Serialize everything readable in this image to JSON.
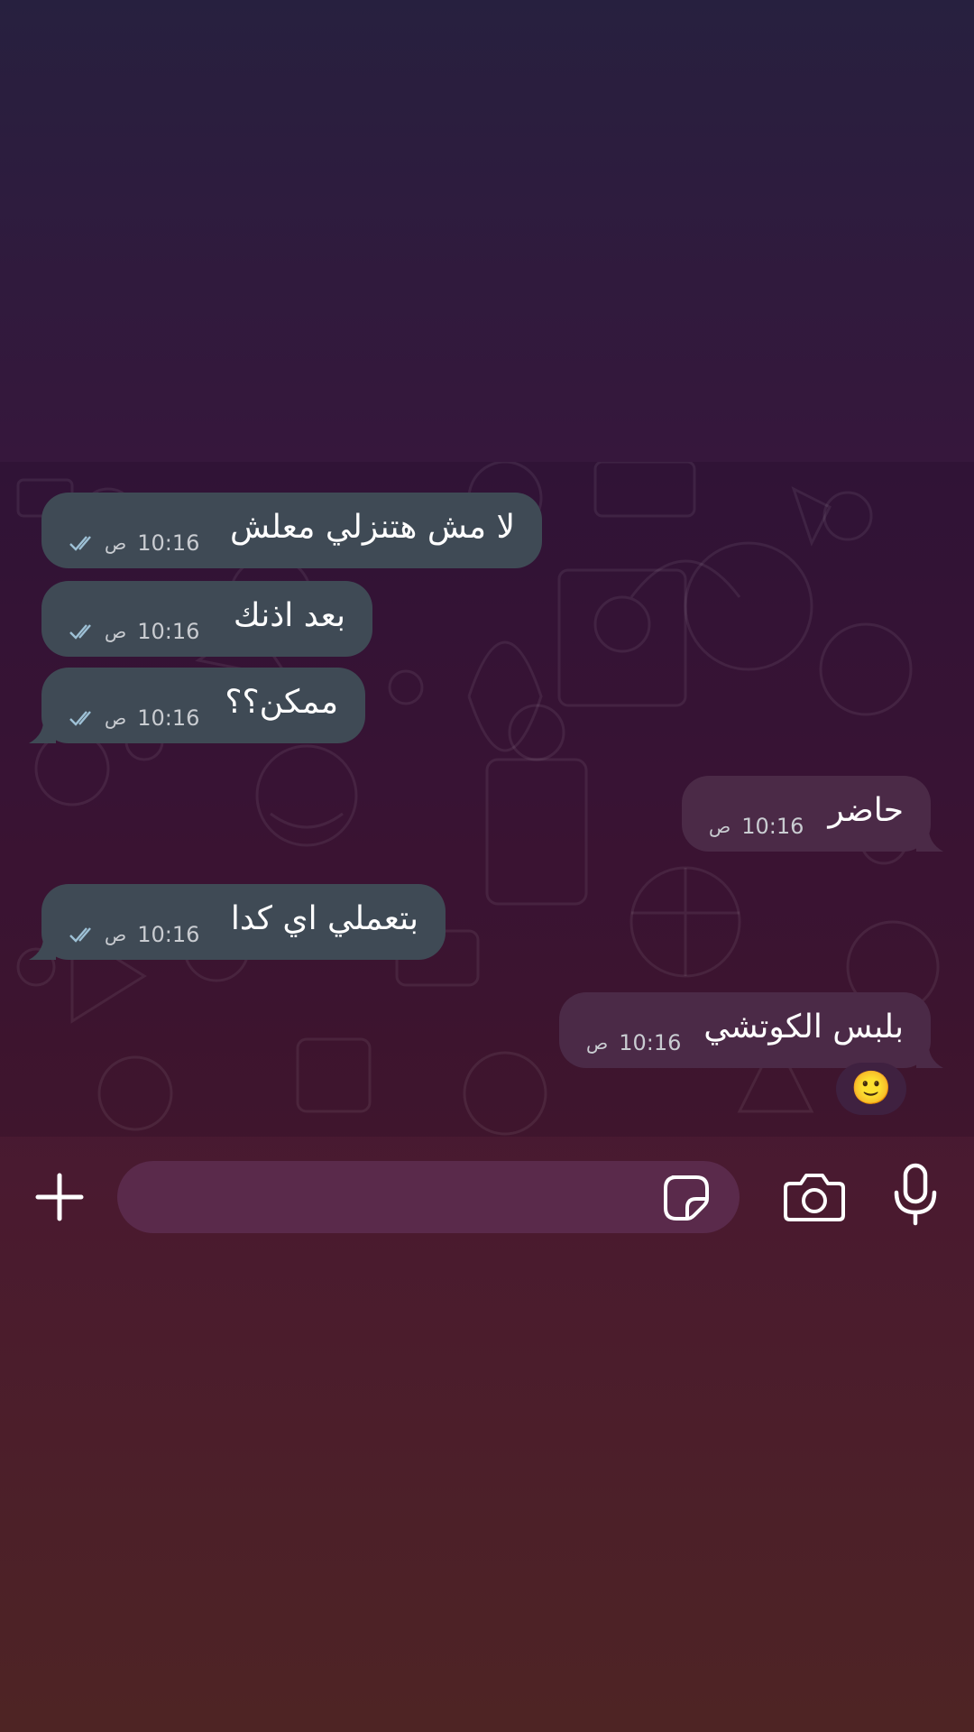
{
  "messages": [
    {
      "text": "لا مش هتنزلي معلش",
      "time": "10:16",
      "ampm": "ص",
      "direction": "outgoing",
      "status": "read"
    },
    {
      "text": "بعد اذنك",
      "time": "10:16",
      "ampm": "ص",
      "direction": "outgoing",
      "status": "read"
    },
    {
      "text": "ممكن؟؟",
      "time": "10:16",
      "ampm": "ص",
      "direction": "outgoing",
      "status": "read"
    },
    {
      "text": "حاضر",
      "time": "10:16",
      "ampm": "ص",
      "direction": "incoming"
    },
    {
      "text": "بتعملي اي كدا",
      "time": "10:16",
      "ampm": "ص",
      "direction": "outgoing",
      "status": "read"
    },
    {
      "text": "بلبس الكوتشي",
      "time": "10:16",
      "ampm": "ص",
      "direction": "incoming",
      "reaction": "🙂"
    }
  ],
  "composer": {
    "message_input_value": "",
    "icons": {
      "attach": "plus-icon",
      "sticker": "sticker-icon",
      "camera": "camera-icon",
      "voice": "microphone-icon"
    }
  },
  "colors": {
    "outgoing_bubble": "#3f4a55",
    "incoming_bubble": "#4b2a47",
    "read_ticks": "#9ec1d6"
  }
}
